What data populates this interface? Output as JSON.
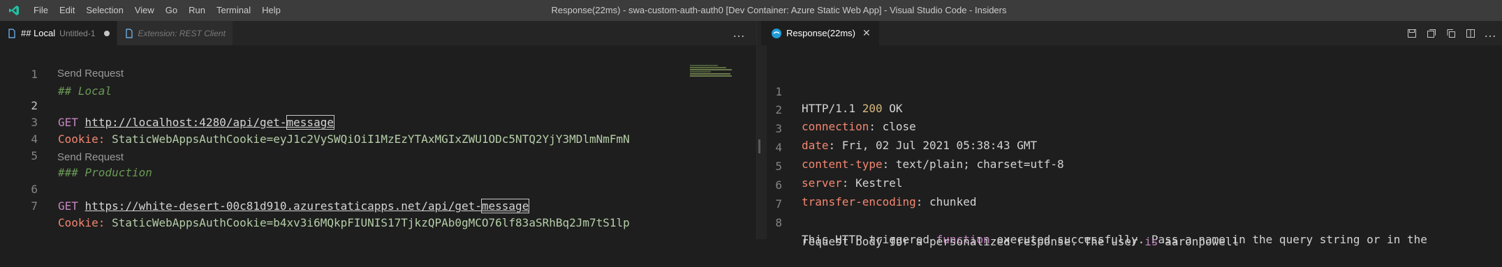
{
  "titlebar": {
    "menu": [
      "File",
      "Edit",
      "Selection",
      "View",
      "Go",
      "Run",
      "Terminal",
      "Help"
    ],
    "window_title": "Response(22ms) - swa-custom-auth-auth0 [Dev Container: Azure Static Web App] - Visual Studio Code - Insiders",
    "app_icon": "vscode-insiders-icon"
  },
  "left_editor": {
    "tabs": [
      {
        "label": "## Local",
        "description": "Untitled-1",
        "dirty": true,
        "active": true,
        "icon": "file-icon"
      },
      {
        "label": "Extension: REST Client",
        "preview": true,
        "icon": "file-icon"
      }
    ],
    "more_actions": "…",
    "codelens": "Send Request",
    "lines": {
      "l1": {
        "num": "1",
        "text": "## Local"
      },
      "l2": {
        "num": "2",
        "method": "GET",
        "url_a": "http://localhost:4280/api/get-",
        "url_b": "message"
      },
      "l3": {
        "num": "3",
        "key": "Cookie:",
        "value": "StaticWebAppsAuthCookie=eyJ1c2VySWQiOiI1MzEzYTAxMGIxZWU1ODc5NTQ2YjY3MDlmNmFmN"
      },
      "l4": {
        "num": "4"
      },
      "l5": {
        "num": "5",
        "text": "### Production"
      },
      "l6": {
        "num": "6",
        "method": "GET",
        "url_a": "https://white-desert-00c81d910.azurestaticapps.net/api/get-",
        "url_b": "message"
      },
      "l7": {
        "num": "7",
        "key": "Cookie:",
        "value": "StaticWebAppsAuthCookie=b4xv3i6MQkpFIUNIS17TjkzQPAb0gMCO76lf83aSRhBq2Jm7tS1lp"
      }
    }
  },
  "right_editor": {
    "tab": {
      "label": "Response(22ms)",
      "icon": "rest-client-icon"
    },
    "actions": [
      "open-preview-icon",
      "split-icon",
      "copy-icon",
      "layout-split-icon",
      "more-icon"
    ],
    "lines": {
      "l1": {
        "num": "1",
        "proto": "HTTP/1.1",
        "status": "200",
        "reason": "OK"
      },
      "l2": {
        "num": "2",
        "key": "connection",
        "value": "close"
      },
      "l3": {
        "num": "3",
        "key": "date",
        "value": "Fri, 02 Jul 2021 05:38:43 GMT"
      },
      "l4": {
        "num": "4",
        "key": "content-type",
        "value": "text/plain; charset=utf-8"
      },
      "l5": {
        "num": "5",
        "key": "server",
        "value": "Kestrel"
      },
      "l6": {
        "num": "6",
        "key": "transfer-encoding",
        "value": "chunked"
      },
      "l7": {
        "num": "7"
      },
      "l8": {
        "num": "8",
        "a": "This HTTP triggered ",
        "kw1": "function",
        "b": " executed successfully. Pass a name in the query string or in the",
        "c": "request body for a personalized response. The user ",
        "kw2": "is",
        "d": " aaronpowell"
      }
    }
  },
  "colors": {
    "titlebar_bg": "#3c3c3c",
    "editor_bg": "#1e1e1e",
    "accent": "#0e639c"
  }
}
